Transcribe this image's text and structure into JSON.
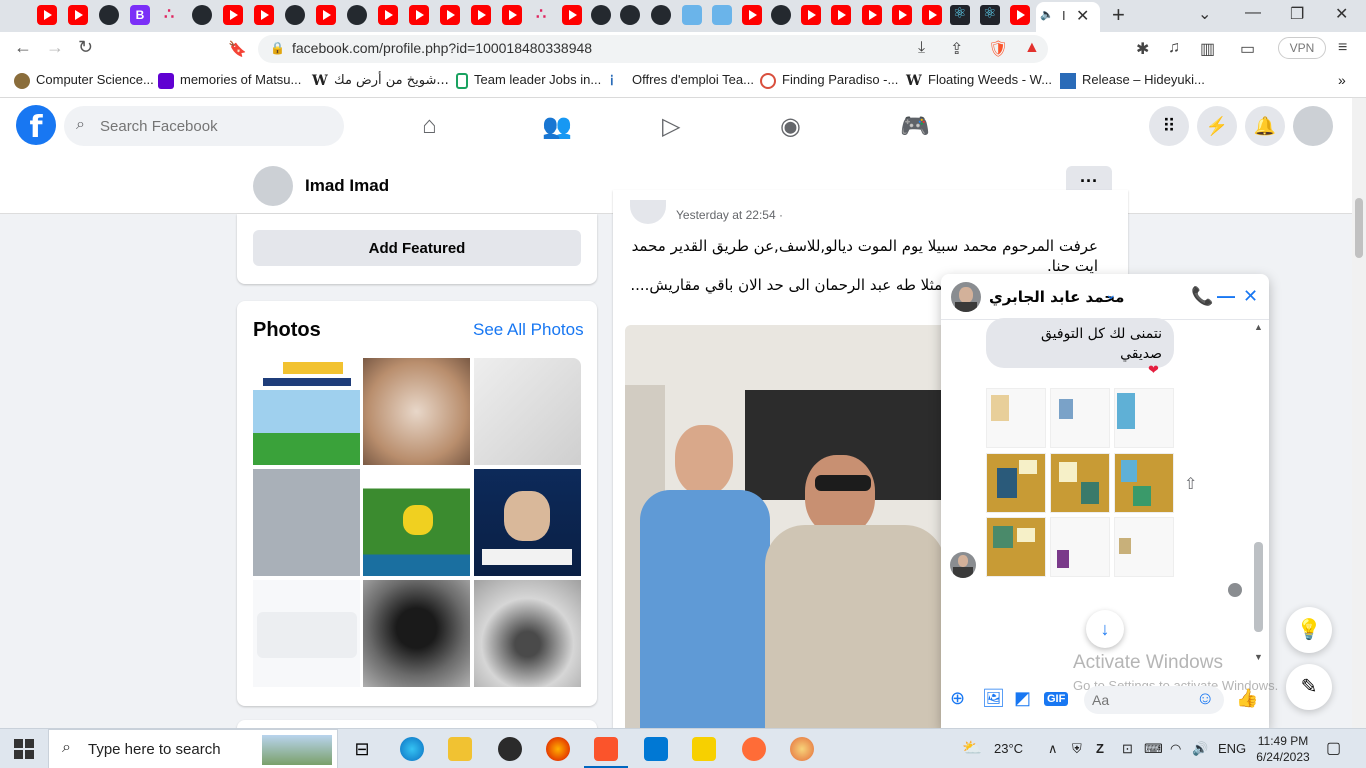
{
  "browser": {
    "url": "facebook.com/profile.php?id=100018480338948",
    "vpn_label": "VPN",
    "active_tab_label": "I",
    "bookmarks": [
      {
        "label": "Computer Science...",
        "color": "#8a6d3b"
      },
      {
        "label": "memories of Matsu...",
        "color": "#6001d2"
      },
      {
        "label": "شويخ من أرض مك...",
        "color": "#ffffff"
      },
      {
        "label": "Team leader Jobs in...",
        "color": "#1aa260"
      },
      {
        "label": "Offres d'emploi Tea...",
        "color": "#ffffff"
      },
      {
        "label": "Finding Paradiso -...",
        "color": "#d94f3d"
      },
      {
        "label": "Floating Weeds - W...",
        "color": "#ffffff"
      },
      {
        "label": "Release – Hideyuki...",
        "color": "#2a6bb8"
      }
    ]
  },
  "facebook": {
    "brand_color": "#1877f2",
    "search_placeholder": "Search Facebook",
    "profile_name": "Imad Imad",
    "add_featured_label": "Add Featured",
    "photos_title": "Photos",
    "see_all_label": "See All Photos",
    "post": {
      "meta": "Yesterday at 22:54 ·",
      "text1": "عرفت المرحوم محمد سبيلا يوم الموت ديالو,للاسف,عن طريق القدير محمد ايت حنا.",
      "text2": "فمثلا طه عبد الرحمان الى حد الان باقي مقاريش...."
    }
  },
  "messenger": {
    "contact_name": "محمد عابد الجابري",
    "message": "نتمنى لك كل التوفيق صديقي",
    "input_placeholder": "Aa",
    "gif_label": "GIF"
  },
  "watermark": {
    "line1": "Activate Windows",
    "line2": "Go to Settings to activate Windows."
  },
  "taskbar": {
    "search_placeholder": "Type here to search",
    "temperature": "23°C",
    "language": "ENG",
    "time": "11:49 PM",
    "date": "6/24/2023"
  }
}
